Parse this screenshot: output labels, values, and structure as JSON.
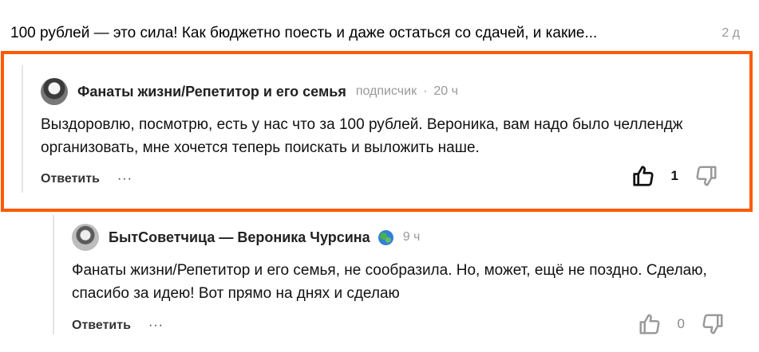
{
  "post": {
    "title": "100 рублей — это сила! Как бюджетно поесть и даже остаться со сдачей, и какие...",
    "age": "2 д"
  },
  "comments": [
    {
      "author": "Фанаты жизни/Репетитор и его семья",
      "role": "подписчик",
      "separator": "·",
      "time": "20 ч",
      "text": "Выздоровлю, посмотрю, есть у нас что за 100 рублей. Вероника, вам надо было челлендж организовать, мне хочется теперь поискать и выложить наше.",
      "reply_label": "Ответить",
      "more_label": "···",
      "likes": "1",
      "highlighted": true,
      "highlight_color": "#ff5a00"
    },
    {
      "author": "БытСоветчица — Вероника Чурсина",
      "badge_icon": "globe-icon",
      "time": "9 ч",
      "text": "Фанаты жизни/Репетитор и его семья, не сообразила. Но, может, ещё не поздно. Сделаю, спасибо за идею! Вот прямо на днях и сделаю",
      "reply_label": "Ответить",
      "more_label": "···",
      "likes": "0"
    }
  ]
}
